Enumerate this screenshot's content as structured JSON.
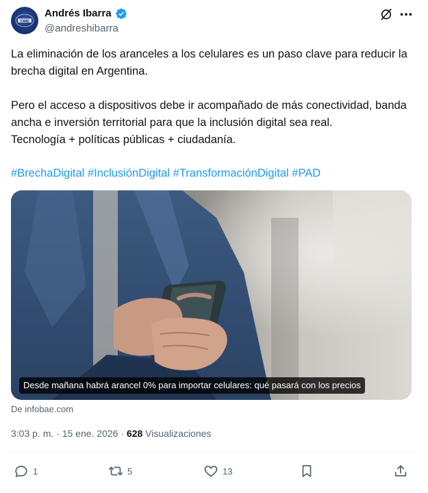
{
  "author": {
    "name": "Andrés Ibarra",
    "handle": "@andreshibarra",
    "verified": true
  },
  "icons": {
    "verified": "verified-badge-icon",
    "grok": "grok-icon",
    "more": "more-dots-icon",
    "reply": "reply-icon",
    "repost": "repost-icon",
    "like": "heart-icon",
    "bookmark": "bookmark-icon",
    "share": "share-icon"
  },
  "tweet": {
    "paragraph1": "La eliminación de los aranceles a los celulares es un paso clave para reducir la brecha digital en Argentina.",
    "paragraph2": "Pero el acceso a dispositivos debe ir acompañado de más conectividad, banda ancha e inversión territorial para que la inclusión digital sea real.",
    "paragraph3": "Tecnología + políticas públicas + ciudadanía.",
    "hashtags": [
      "#BrechaDigital",
      "#InclusiónDigital",
      "#TransformaciónDigital",
      "#PAD"
    ]
  },
  "card": {
    "caption": "Desde mañana habrá arancel 0% para importar celulares: qué pasará con los precios",
    "source": "De infobae.com"
  },
  "meta": {
    "time": "3:03 p. m.",
    "separator": "·",
    "date": "15 ene. 2026",
    "views_count": "628",
    "views_label": "Visualizaciones"
  },
  "actions": {
    "replies": "1",
    "reposts": "5",
    "likes": "13"
  },
  "colors": {
    "link": "#1d9bf0",
    "text": "#0f1419",
    "muted": "#536471",
    "verified": "#1d9bf0"
  }
}
